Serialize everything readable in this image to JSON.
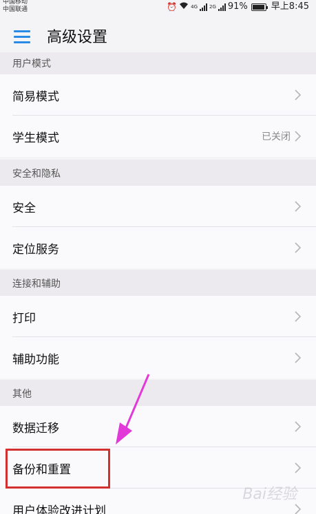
{
  "status_bar": {
    "carrier1": "中国移动",
    "carrier2": "中国联通",
    "net1": "4G",
    "net2": "2G",
    "battery": "91%",
    "time": "早上8:45"
  },
  "appbar": {
    "title": "高级设置"
  },
  "sections": [
    {
      "header": "用户模式",
      "items": [
        {
          "label": "简易模式",
          "value": ""
        },
        {
          "label": "学生模式",
          "value": "已关闭"
        }
      ]
    },
    {
      "header": "安全和隐私",
      "items": [
        {
          "label": "安全",
          "value": ""
        },
        {
          "label": "定位服务",
          "value": ""
        }
      ]
    },
    {
      "header": "连接和辅助",
      "items": [
        {
          "label": "打印",
          "value": ""
        },
        {
          "label": "辅助功能",
          "value": ""
        }
      ]
    },
    {
      "header": "其他",
      "items": [
        {
          "label": "数据迁移",
          "value": ""
        },
        {
          "label": "备份和重置",
          "value": ""
        },
        {
          "label": "用户体验改进计划",
          "value": ""
        }
      ]
    }
  ],
  "watermark": "Bai经验",
  "colors": {
    "accent": "#2a8be6",
    "highlight": "#d3312f",
    "arrow": "#e23ad8"
  }
}
